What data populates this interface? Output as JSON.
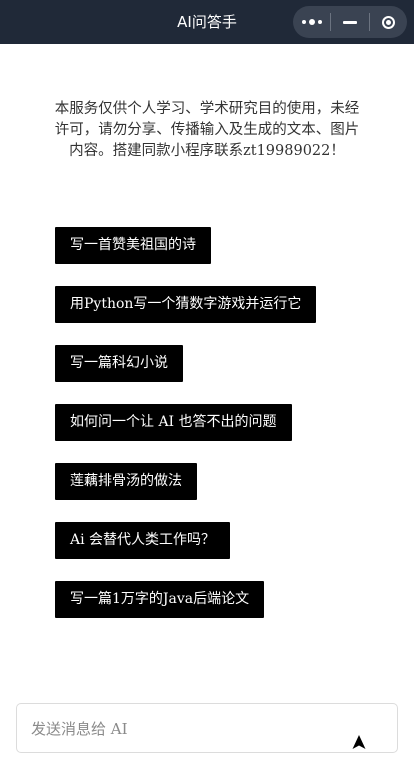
{
  "header": {
    "title": "AI问答手"
  },
  "capsule": {
    "more_icon": "more-dots-icon",
    "minimize_icon": "minimize-icon",
    "close_icon": "target-icon"
  },
  "notice": {
    "text": "本服务仅供个人学习、学术研究目的使用，未经许可，请勿分享、传播输入及生成的文本、图片内容。搭建同款小程序联系zt19989022！"
  },
  "suggestions": [
    {
      "label": "写一首赞美祖国的诗"
    },
    {
      "label": "用Python写一个猜数字游戏并运行它"
    },
    {
      "label": "写一篇科幻小说"
    },
    {
      "label": "如何问一个让 AI 也答不出的问题"
    },
    {
      "label": "莲藕排骨汤的做法"
    },
    {
      "label": "Ai 会替代人类工作吗？"
    },
    {
      "label": "写一篇1万字的Java后端论文"
    }
  ],
  "input": {
    "placeholder": "发送消息给 AI",
    "value": "",
    "send_icon": "send-arrow-icon"
  },
  "colors": {
    "header_bg": "#202938",
    "button_bg": "#000000",
    "button_text": "#ffffff"
  }
}
